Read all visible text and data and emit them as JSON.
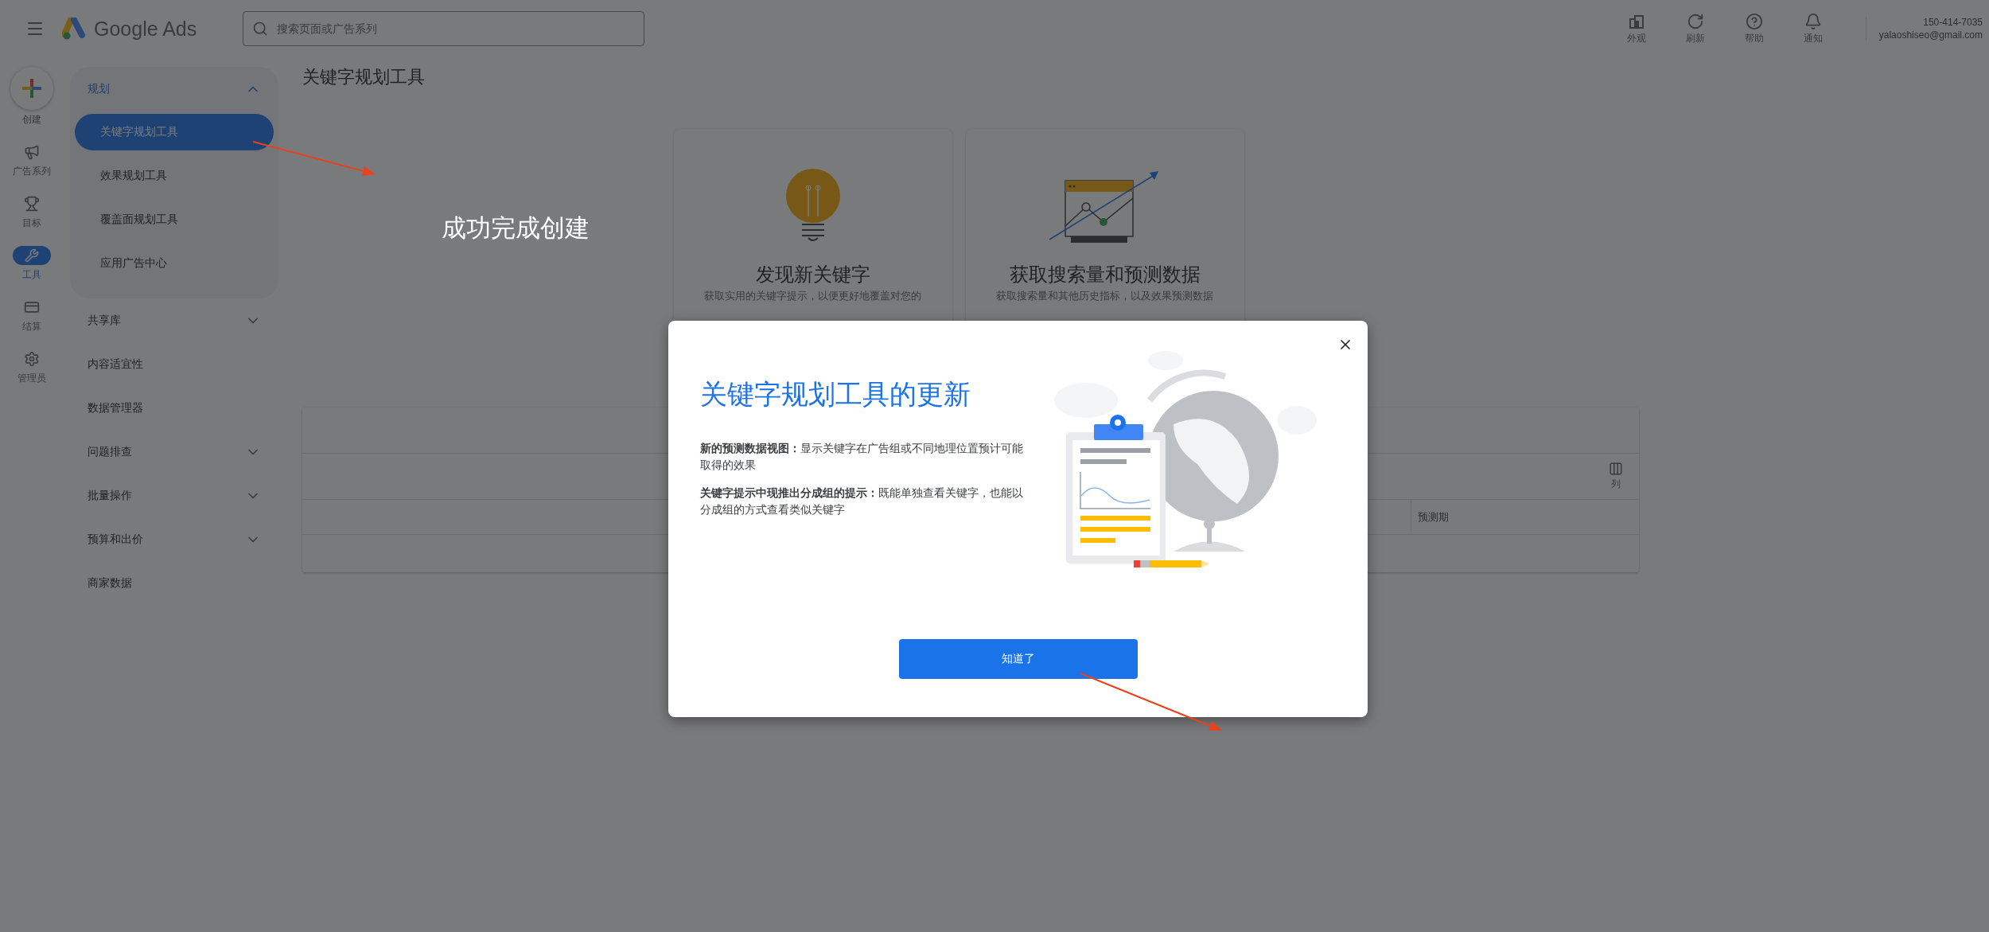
{
  "header": {
    "logo_text": "Google Ads",
    "search": {
      "placeholder": "搜索页面或广告系列"
    },
    "actions": [
      {
        "kind": "appearance",
        "label": "外观"
      },
      {
        "kind": "refresh",
        "label": "刷新"
      },
      {
        "kind": "help",
        "label": "帮助"
      },
      {
        "kind": "notifications",
        "label": "通知"
      }
    ],
    "account": {
      "phone": "150-414-7035",
      "email": "yalaoshiseo@gmail.com"
    }
  },
  "nav_rail": [
    {
      "kind": "create",
      "label": "创建",
      "selected": false
    },
    {
      "kind": "campaigns",
      "label": "广告系列",
      "selected": false
    },
    {
      "kind": "goals",
      "label": "目标",
      "selected": false
    },
    {
      "kind": "tools",
      "label": "工具",
      "selected": true
    },
    {
      "kind": "billing",
      "label": "结算",
      "selected": false
    },
    {
      "kind": "admin",
      "label": "管理员",
      "selected": false
    }
  ],
  "sidebar": {
    "sections": [
      {
        "kind": "group",
        "label": "规划",
        "expanded": true,
        "children": [
          {
            "label": "关键字规划工具",
            "selected": true
          },
          {
            "label": "效果规划工具",
            "selected": false
          },
          {
            "label": "覆盖面规划工具",
            "selected": false
          },
          {
            "label": "应用广告中心",
            "selected": false
          }
        ]
      },
      {
        "kind": "group",
        "label": "共享库",
        "expanded": false
      },
      {
        "kind": "link",
        "label": "内容适宜性"
      },
      {
        "kind": "link",
        "label": "数据管理器"
      },
      {
        "kind": "group",
        "label": "问题排查",
        "expanded": false
      },
      {
        "kind": "group",
        "label": "批量操作",
        "expanded": false
      },
      {
        "kind": "group",
        "label": "预算和出价",
        "expanded": false
      },
      {
        "kind": "link",
        "label": "商家数据"
      }
    ]
  },
  "page": {
    "title": "关键字规划工具",
    "cards": [
      {
        "kind": "bulb",
        "title": "发现新关键字",
        "description": "获取实用的关键字提示，以便更好地覆盖对您的"
      },
      {
        "kind": "chart",
        "title": "获取搜索量和预测数据",
        "description": "获取搜索量和其他历史指标，以及效果预测数据"
      }
    ],
    "table": {
      "columns_button": "列",
      "columns": [
        "预测期"
      ]
    }
  },
  "dialog": {
    "title": "关键字规划工具的更新",
    "paragraphs": [
      "**新的预测数据视图：**显示关键字在广告组或不同地理位置预计可能取得的效果",
      "**关键字提示中现推出分成组的提示：**既能单独查看关键字，也能以分成组的方式查看类似关键字"
    ],
    "button": "知道了"
  },
  "annotation": {
    "note": "成功完成创建"
  }
}
